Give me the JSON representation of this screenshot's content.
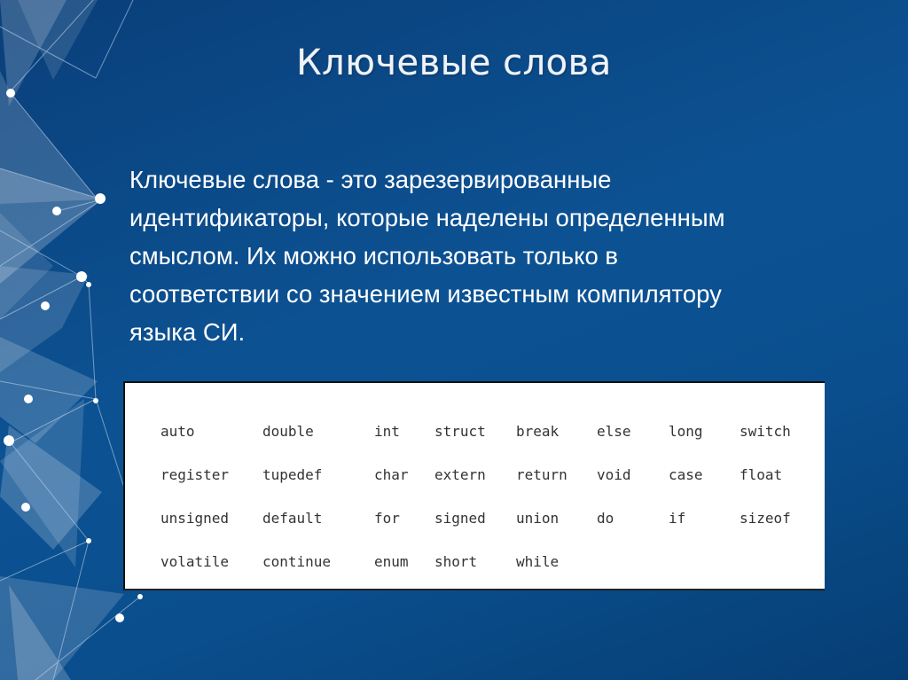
{
  "slide": {
    "title": "Ключевые слова",
    "body": "Ключевые слова - это зарезервированные идентификаторы, которые наделены определенным смыслом. Их можно использовать только в соответствии со значением известным компилятору языка СИ.",
    "body_lines": [
      "Ключевые слова - это зарезервированные",
      "идентификаторы, которые наделены определенным",
      "смыслом. Их можно использовать только в",
      "соответствии со значением известным компилятору",
      "языка СИ."
    ],
    "keywords_table": [
      [
        "auto",
        "double",
        "int",
        "struct",
        "break",
        "else",
        "long",
        "switch"
      ],
      [
        "register",
        "tupedef",
        "char",
        "extern",
        "return",
        "void",
        "case",
        "float"
      ],
      [
        "unsigned",
        "default",
        "for",
        "signed",
        "union",
        "do",
        "if",
        "sizeof"
      ],
      [
        "volatile",
        "continue",
        "enum",
        "short",
        "while",
        "",
        "",
        ""
      ]
    ]
  },
  "colors": {
    "background": "#0c5293",
    "background_dark": "#063e74",
    "title_text": "#eef3fa",
    "body_text": "#ffffff",
    "table_bg": "#ffffff",
    "table_text": "#333333"
  }
}
